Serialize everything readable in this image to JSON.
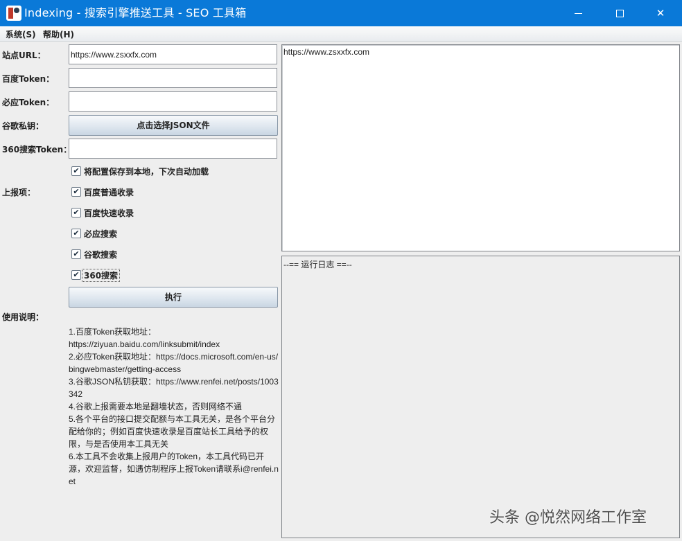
{
  "window": {
    "title": "Indexing - 搜索引擎推送工具 - SEO 工具箱",
    "app_icon": "app-logo-icon",
    "controls": {
      "minimize": "minimize-icon",
      "maximize": "maximize-icon",
      "close": "✕"
    },
    "title_bar_color": "#0a79d8"
  },
  "menu": {
    "system": "系统(S)",
    "help": "帮助(H)"
  },
  "form": {
    "site_url_label": "站点URL：",
    "site_url_value": "https://www.zsxxfx.com",
    "baidu_token_label": "百度Token：",
    "baidu_token_value": "",
    "bing_token_label": "必应Token：",
    "bing_token_value": "",
    "google_key_label": "谷歌私钥：",
    "google_key_button": "点击选择JSON文件",
    "token360_label": "360搜索Token：",
    "token360_value": "",
    "save_config_label": "将配置保存到本地，下次自动加载",
    "save_config_checked": true,
    "report_label": "上报项：",
    "report_items": [
      {
        "label": "百度普通收录",
        "checked": true
      },
      {
        "label": "百度快速收录",
        "checked": true
      },
      {
        "label": "必应搜索",
        "checked": true
      },
      {
        "label": "谷歌搜索",
        "checked": true
      },
      {
        "label": "360搜索",
        "checked": true
      }
    ],
    "check_mark": "✔",
    "run_button": "执行",
    "usage_label": "使用说明："
  },
  "usage_lines": [
    "1.百度Token获取地址：\nhttps://ziyuan.baidu.com/linksubmit/index",
    "2.必应Token获取地址：https://docs.microsoft.com/en-us/bingwebmaster/getting-access",
    "3.谷歌JSON私钥获取：https://www.renfei.net/posts/1003342",
    "4.谷歌上报需要本地是翻墙状态，否则网络不通",
    "5.各个平台的接口提交配额与本工具无关，是各个平台分配给你的；例如百度快速收录是百度站长工具给予的权限，与是否使用本工具无关",
    "6.本工具不会收集上报用户的Token，本工具代码已开源，欢迎监督，如遇仿制程序上报Token请联系i@renfei.net"
  ],
  "url_area_text": "https://www.zsxxfx.com",
  "log_area_text": "--== 运行日志 ==--",
  "watermark": "头条 @悦然网络工作室"
}
